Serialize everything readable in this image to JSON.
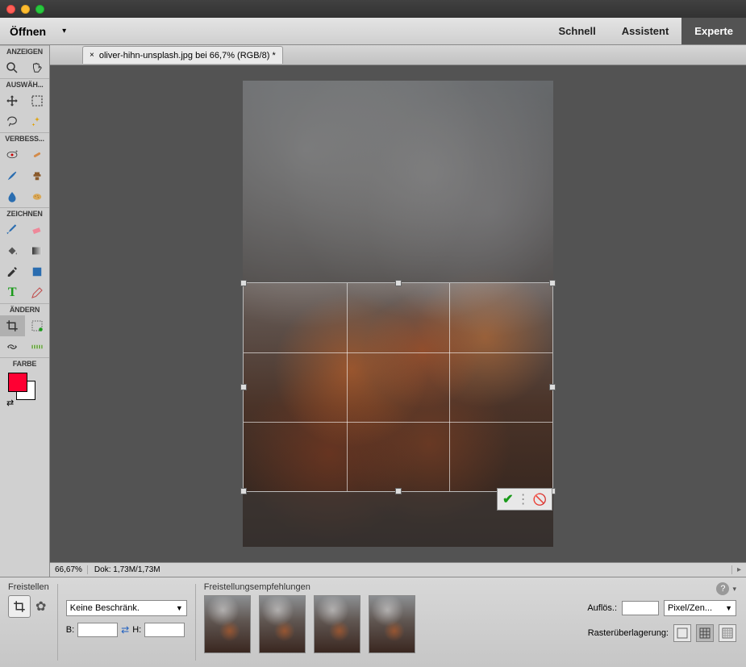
{
  "menubar": {
    "open_label": "Öffnen",
    "tabs": {
      "quick": "Schnell",
      "assistant": "Assistent",
      "expert": "Experte"
    }
  },
  "document": {
    "tab_title": "oliver-hihn-unsplash.jpg bei 66,7% (RGB/8) *"
  },
  "toolbox": {
    "sections": {
      "view": "ANZEIGEN",
      "select": "AUSWÄH...",
      "enhance": "VERBESS...",
      "draw": "ZEICHNEN",
      "modify": "ÄNDERN",
      "color": "FARBE"
    },
    "colors": {
      "foreground": "#ff0033",
      "background": "#ffffff"
    }
  },
  "status": {
    "zoom": "66,67%",
    "docinfo": "Dok: 1,73M/1,73M"
  },
  "options": {
    "tool_label": "Freistellen",
    "suggestions_label": "Freistellungsempfehlungen",
    "aspect_dropdown": "Keine Beschränk.",
    "width_label": "B:",
    "height_label": "H:",
    "resolution_label": "Auflös.:",
    "resolution_unit": "Pixel/Zen...",
    "overlay_label": "Rasterüberlagerung:"
  }
}
